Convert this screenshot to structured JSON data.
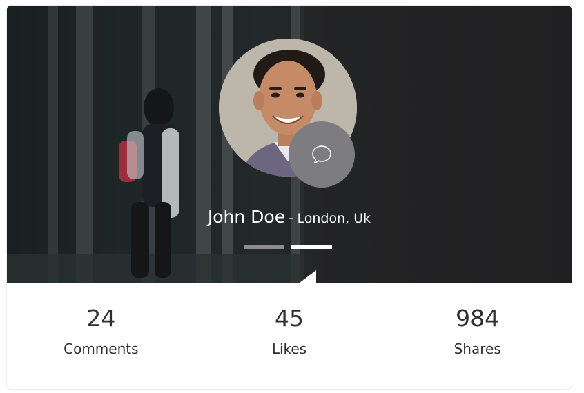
{
  "profile": {
    "name": "John Doe",
    "separator": "-",
    "location": "London, Uk"
  },
  "carousel": {
    "slides": 2,
    "active_index": 1
  },
  "stats": [
    {
      "value": "24",
      "label": "Comments"
    },
    {
      "value": "45",
      "label": "Likes"
    },
    {
      "value": "984",
      "label": "Shares"
    }
  ],
  "icons": {
    "chat": "chat-bubble-icon"
  },
  "colors": {
    "chat_button": "#7d7c80",
    "indicator_active": "#ffffff",
    "indicator_inactive": "#8c8c8c",
    "stat_text": "#2f2f2f"
  }
}
